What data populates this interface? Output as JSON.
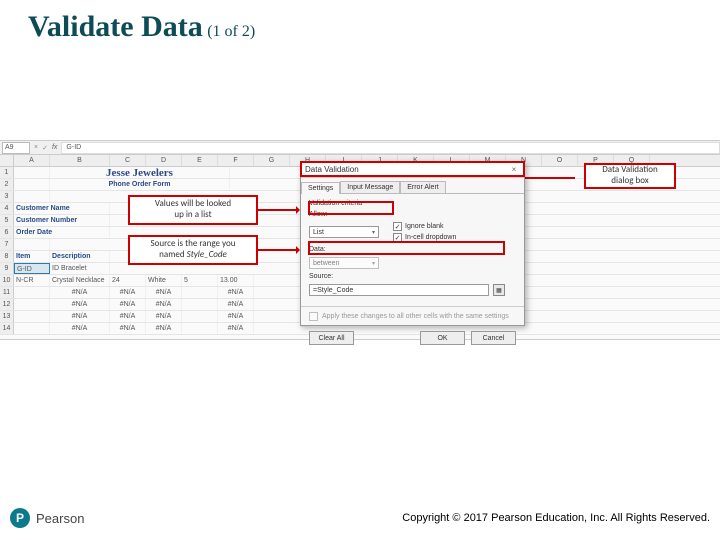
{
  "title": {
    "main": "Validate Data",
    "sub": "(1 of 2)"
  },
  "formula_bar": {
    "cell_ref": "A9",
    "formula": "G-ID"
  },
  "columns": [
    "A",
    "B",
    "C",
    "D",
    "E",
    "F",
    "G",
    "H",
    "I",
    "J",
    "K",
    "L",
    "M",
    "N",
    "O",
    "P",
    "Q"
  ],
  "rows": {
    "1_title": "Jesse Jewelers",
    "2_subtitle": "Phone Order Form",
    "labels": {
      "customer_name": "Customer Name",
      "customer_number": "Customer Number",
      "order_date": "Order Date",
      "item": "Item",
      "description": "Description"
    },
    "r9": {
      "a": "G-ID",
      "b": "ID Bracelet"
    },
    "r10": {
      "a": "N-CR",
      "b": "Crystal Necklace",
      "c": "24",
      "d": "White",
      "e": "5",
      "f": "13.00"
    },
    "na": "#N/A"
  },
  "callouts": {
    "c1a": "Values will be looked",
    "c1b": "up in a list",
    "c2a": "Source is the range you",
    "c2b_pre": "named ",
    "c2b_ital": "Style_Code",
    "c3a": "Data Validation",
    "c3b": "dialog box"
  },
  "dialog": {
    "title": "Data Validation",
    "tabs": {
      "settings": "Settings",
      "input": "Input Message",
      "error": "Error Alert"
    },
    "criteria_label": "Validation criteria",
    "allow_label": "Allow:",
    "allow_value": "List",
    "ignore_blank": "Ignore blank",
    "incell": "In-cell dropdown",
    "data_label": "Data:",
    "data_value": "between",
    "source_label": "Source:",
    "source_value": "=Style_Code",
    "apply": "Apply these changes to all other cells with the same settings",
    "clear": "Clear All",
    "ok": "OK",
    "cancel": "Cancel"
  },
  "footer": {
    "brand_initial": "P",
    "brand": "Pearson",
    "copyright": "Copyright © 2017 Pearson Education, Inc. All Rights Reserved."
  }
}
